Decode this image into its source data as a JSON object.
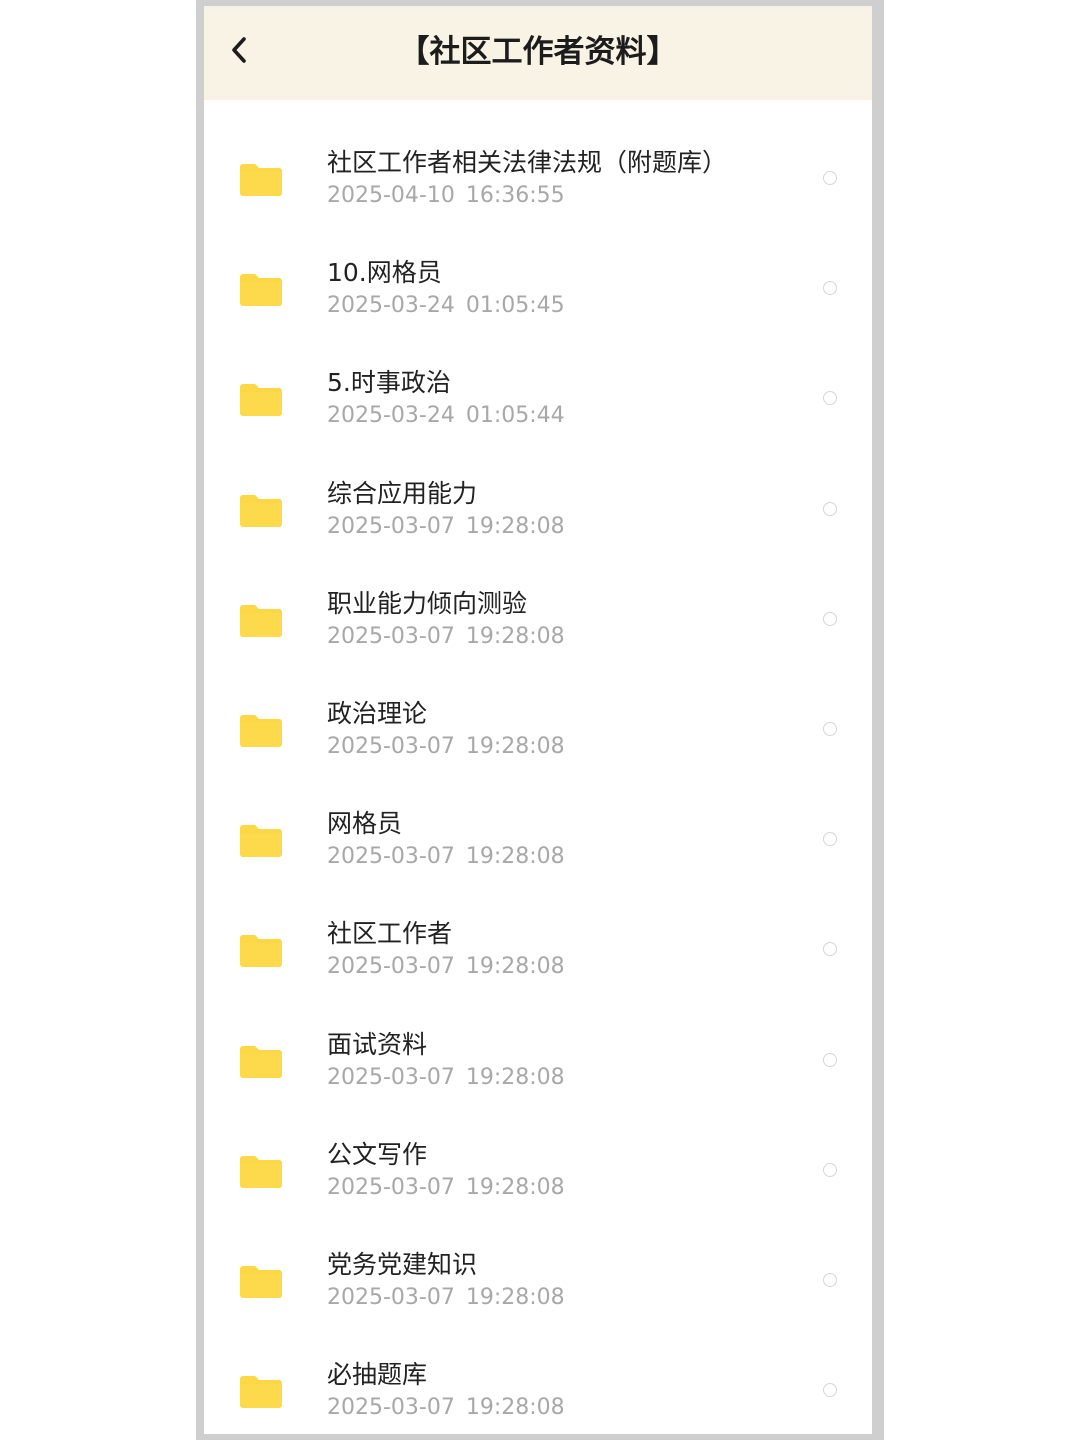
{
  "header": {
    "title": "【社区工作者资料】",
    "back_icon": "chevron-left-icon"
  },
  "colors": {
    "header_bg": "#f8f3e4",
    "folder": "#fcd746",
    "frame": "#cfcfcf",
    "name_text": "#222222",
    "date_text": "#a8a8a8"
  },
  "files": [
    {
      "name": "社区工作者相关法律法规（附题库）",
      "date": "2025-04-10  16:36:55",
      "icon": "folder-icon"
    },
    {
      "name": "10.网格员",
      "date": "2025-03-24  01:05:45",
      "icon": "folder-icon"
    },
    {
      "name": "5.时事政治",
      "date": "2025-03-24  01:05:44",
      "icon": "folder-icon"
    },
    {
      "name": "综合应用能力",
      "date": "2025-03-07  19:28:08",
      "icon": "folder-icon"
    },
    {
      "name": "职业能力倾向测验",
      "date": "2025-03-07  19:28:08",
      "icon": "folder-icon"
    },
    {
      "name": "政治理论",
      "date": "2025-03-07  19:28:08",
      "icon": "folder-icon"
    },
    {
      "name": "网格员",
      "date": "2025-03-07  19:28:08",
      "icon": "folder-icon"
    },
    {
      "name": "社区工作者",
      "date": "2025-03-07  19:28:08",
      "icon": "folder-icon"
    },
    {
      "name": "面试资料",
      "date": "2025-03-07  19:28:08",
      "icon": "folder-icon"
    },
    {
      "name": "公文写作",
      "date": "2025-03-07  19:28:08",
      "icon": "folder-icon"
    },
    {
      "name": "党务党建知识",
      "date": "2025-03-07  19:28:08",
      "icon": "folder-icon"
    },
    {
      "name": "必抽题库",
      "date": "2025-03-07  19:28:08",
      "icon": "folder-icon"
    }
  ]
}
